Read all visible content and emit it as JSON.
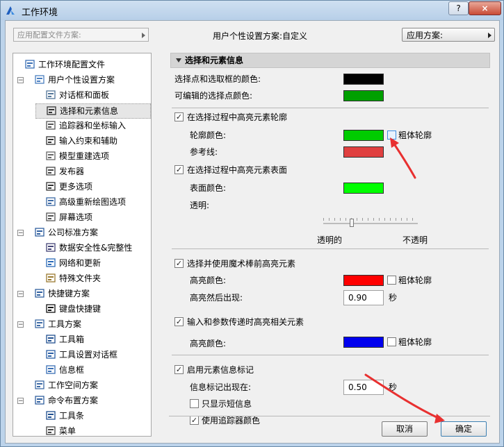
{
  "window": {
    "title": "工作环境",
    "help_label": "?",
    "close_label": "×"
  },
  "topbar": {
    "profile_placeholder": "应用配置文件方案:",
    "scheme_label": "用户个性设置方案:自定义",
    "apply_label": "应用方案:"
  },
  "sidebar": {
    "items": [
      {
        "label": "工作环境配置文件",
        "icon": "profile-icon"
      },
      {
        "label": "用户个性设置方案",
        "icon": "user-settings-icon"
      },
      {
        "label": "对话框和面板",
        "icon": "dialog-panel-icon"
      },
      {
        "label": "选择和元素信息",
        "icon": "selection-info-icon"
      },
      {
        "label": "追踪器和坐标输入",
        "icon": "xyz-tracker-icon"
      },
      {
        "label": "输入约束和辅助",
        "icon": "mouse-constraint-icon"
      },
      {
        "label": "模型重建选项",
        "icon": "model-rebuild-icon"
      },
      {
        "label": "发布器",
        "icon": "publisher-icon"
      },
      {
        "label": "更多选项",
        "icon": "more-options-icon"
      },
      {
        "label": "高级重新绘图选项",
        "icon": "redraw-icon"
      },
      {
        "label": "屏幕选项",
        "icon": "screen-options-icon"
      },
      {
        "label": "公司标准方案",
        "icon": "company-standards-icon"
      },
      {
        "label": "数据安全性&完整性",
        "icon": "data-safety-icon"
      },
      {
        "label": "网络和更新",
        "icon": "network-icon"
      },
      {
        "label": "特殊文件夹",
        "icon": "folder-icon"
      },
      {
        "label": "快捷键方案",
        "icon": "shortcut-scheme-icon"
      },
      {
        "label": "键盘快捷键",
        "icon": "keyboard-shortcut-icon"
      },
      {
        "label": "工具方案",
        "icon": "tool-scheme-icon"
      },
      {
        "label": "工具箱",
        "icon": "toolbox-icon"
      },
      {
        "label": "工具设置对话框",
        "icon": "tool-settings-icon"
      },
      {
        "label": "信息框",
        "icon": "info-box-icon"
      },
      {
        "label": "工作空间方案",
        "icon": "workspace-icon"
      },
      {
        "label": "命令布置方案",
        "icon": "command-layout-icon"
      },
      {
        "label": "工具条",
        "icon": "toolbar-icon"
      },
      {
        "label": "菜单",
        "icon": "menu-icon"
      }
    ]
  },
  "panel": {
    "header": "选择和元素信息",
    "sel_points_color_label": "选择点和选取框的颜色:",
    "editable_points_color_label": "可编辑的选择点颜色:",
    "highlight_outline": {
      "label": "在选择过程中高亮元素轮廓",
      "checked": true
    },
    "outline_color_label": "轮廓颜色:",
    "bold_outline_label": "粗体轮廓",
    "reference_line_label": "参考线:",
    "highlight_surface": {
      "label": "在选择过程中高亮元素表面",
      "checked": true
    },
    "surface_color_label": "表面颜色:",
    "transparency_label": "透明:",
    "transparent_label": "透明的",
    "opaque_label": "不透明",
    "transparency_value": 0.3,
    "magic_wand": {
      "label": "选择并使用魔术棒前高亮元素",
      "checked": true
    },
    "highlight_color_label": "高亮颜色:",
    "highlight_delay_label": "高亮然后出现:",
    "highlight_delay_value": "0.90",
    "seconds_unit": "秒",
    "input_highlight": {
      "label": "输入和参数传递时高亮相关元素",
      "checked": true
    },
    "highlight_color_label2": "高亮颜色:",
    "info_tag": {
      "label": "启用元素信息标记",
      "checked": true
    },
    "info_tag_delay_label": "信息标记出现在:",
    "info_tag_delay_value": "0.50",
    "short_info": {
      "label": "只显示短信息",
      "checked": false
    },
    "tracker_color": {
      "label": "使用追踪器颜色",
      "checked": true
    }
  },
  "colors": {
    "sel_points": "#000000",
    "editable_points": "#00a000",
    "outline": "#00cc00",
    "reference_line": "#e04040",
    "surface": "#00ff00",
    "highlight": "#ff0000",
    "input_highlight": "#0000ee",
    "annotation_arrow": "#e83030"
  },
  "buttons": {
    "cancel": "取消",
    "ok": "确定"
  },
  "check_glyph": "✓"
}
